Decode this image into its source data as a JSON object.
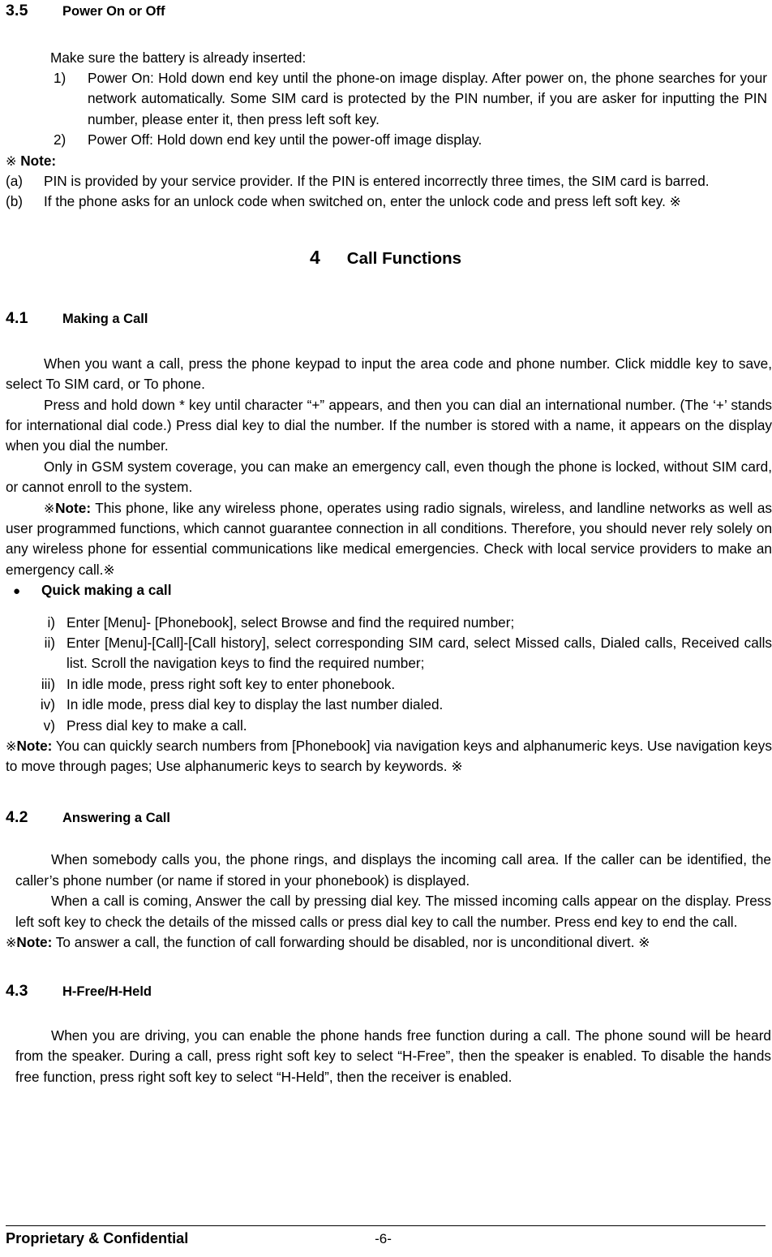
{
  "document": {
    "section_3_5": {
      "number": "3.5",
      "title": "Power On or Off",
      "intro": "Make sure the battery is already inserted:",
      "steps": [
        {
          "marker": "1)",
          "text": "Power On: Hold down end key until the phone-on image display. After power on, the phone searches for your network automatically. Some SIM card is protected by the PIN number, if you are asker for inputting the PIN number, please enter it, then press left soft key."
        },
        {
          "marker": "2)",
          "text": "Power Off: Hold down end key until the power-off image display."
        }
      ],
      "note_mark": "※",
      "note_label": "Note:",
      "notes": [
        {
          "marker": "(a)",
          "text": "PIN is provided by your service provider. If the PIN is entered incorrectly three times, the SIM card is barred."
        },
        {
          "marker": "(b)",
          "text": "If the phone asks for an unlock code when switched on, enter the unlock code and press left soft key. ※"
        }
      ]
    },
    "chapter_4": {
      "number": "4",
      "title": "Call Functions"
    },
    "section_4_1": {
      "number": "4.1",
      "title": "Making a Call",
      "para1": "When you want a call, press the phone keypad to input the area code and phone number. Click middle key to save, select To SIM card, or To phone.",
      "para2": "Press and hold down * key until character “+” appears, and then you can dial an international number. (The ‘+’ stands for international dial code.) Press dial key to dial the number. If the number is stored with a name, it appears on the display when you dial the number.",
      "para3": "Only in GSM system coverage, you can make an emergency call, even though the phone is locked, without SIM card, or cannot enroll to the system.",
      "note_mark": "※",
      "note_label": "Note:",
      "note_text": " This phone, like any wireless phone, operates using radio signals, wireless, and landline networks as well as user programmed functions, which cannot guarantee connection in all conditions. Therefore, you should never rely solely on any wireless phone for essential communications like medical emergencies. Check with local service providers to make an emergency call.※",
      "bullet_symbol": "●",
      "bullet_label": "Quick making a call",
      "quick_steps": [
        {
          "marker": "i)",
          "text": "Enter [Menu]- [Phonebook], select Browse and find the required number;"
        },
        {
          "marker": "ii)",
          "text": "Enter [Menu]-[Call]-[Call history], select corresponding SIM card, select Missed calls, Dialed calls, Received calls list. Scroll the navigation keys to find the required number;"
        },
        {
          "marker": "iii)",
          "text": "In idle mode, press right soft key to enter phonebook."
        },
        {
          "marker": "iv)",
          "text": "In idle mode, press dial key to display the last number dialed."
        },
        {
          "marker": "v)",
          "text": "Press dial key to make a call."
        }
      ],
      "note2_mark": "※",
      "note2_label": "Note:",
      "note2_text": " You can quickly search numbers from [Phonebook] via navigation keys and alphanumeric keys. Use navigation keys to move through pages; Use alphanumeric keys to search by keywords. ※"
    },
    "section_4_2": {
      "number": "4.2",
      "title": "Answering a Call",
      "para1": "When somebody calls you, the phone rings, and displays the incoming call area. If the caller can be identified, the caller’s phone number (or name if stored in your phonebook) is displayed.",
      "para2": "When a call is coming, Answer the call by pressing dial key. The missed incoming calls appear on the display. Press left soft key to check the details of the missed calls or press dial key to call the number. Press end key to end the call.",
      "note_mark": "※",
      "note_label": "Note:",
      "note_text": " To answer a call, the function of call forwarding should be disabled, nor is unconditional divert. ※"
    },
    "section_4_3": {
      "number": "4.3",
      "title": "H-Free/H-Held",
      "para1": "When you are driving, you can enable the phone hands free function during a call. The phone sound will be heard from the speaker. During a call, press right soft key to select “H-Free”, then the speaker is enabled. To disable the hands free function, press right soft key to select “H-Held”, then the receiver is enabled."
    },
    "footer": {
      "left_label": "Proprietary & Confidential",
      "page_number": "-6-"
    }
  }
}
